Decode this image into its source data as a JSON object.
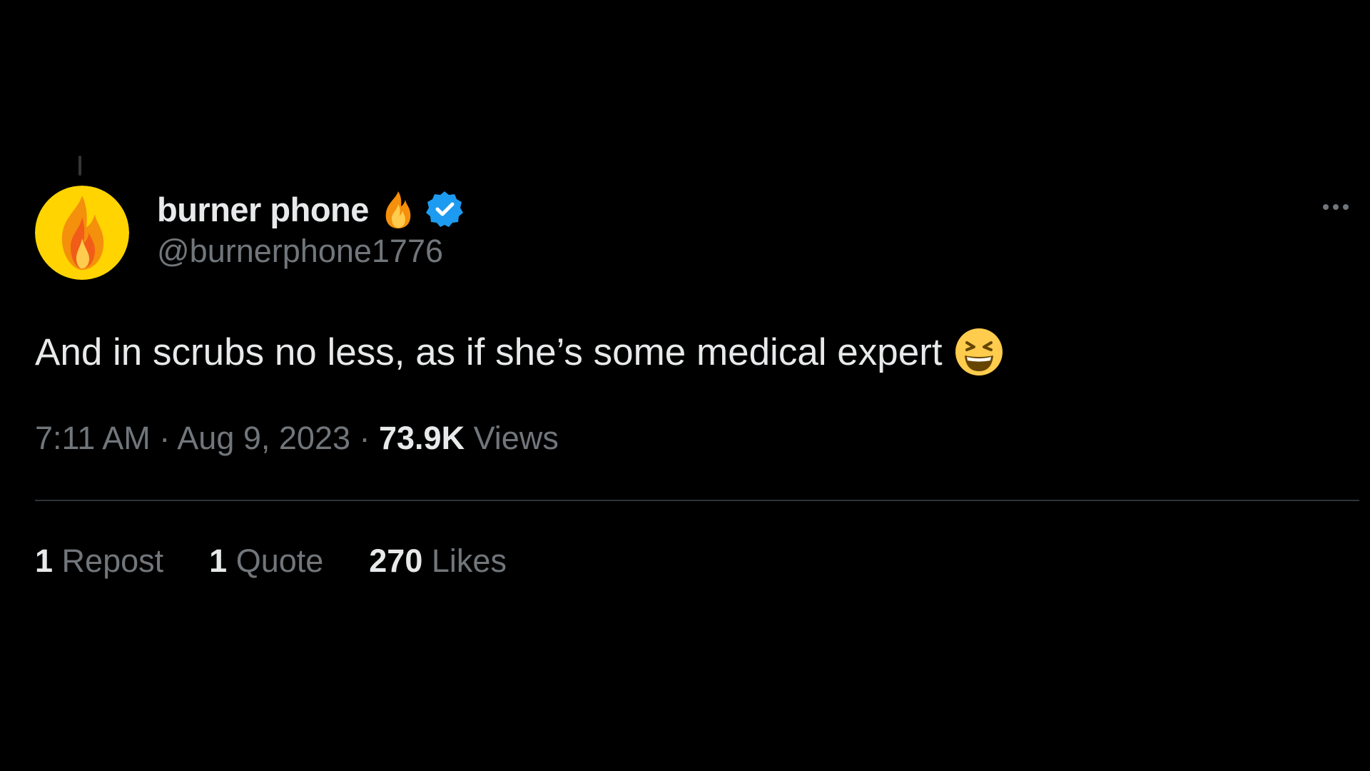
{
  "theme": {
    "background": "#000000",
    "primary_text": "#e7e9ea",
    "secondary_text": "#71767b",
    "verified_blue": "#1d9bf0",
    "divider": "#2f3336"
  },
  "author": {
    "display_name": "burner phone",
    "name_emoji": "fire-emoji",
    "verified_icon": "verified-badge-icon",
    "handle": "@burnerphone1776",
    "avatar": "fire-avatar"
  },
  "tweet": {
    "text": "And in scrubs no less, as if she’s some medical expert",
    "emoji": "grinning-squinting-face-emoji"
  },
  "meta": {
    "time": "7:11 AM",
    "separator": " · ",
    "date": "Aug 9, 2023",
    "views_count": "73.9K",
    "views_label": "Views"
  },
  "stats": {
    "reposts_count": "1",
    "reposts_label": "Repost",
    "quotes_count": "1",
    "quotes_label": "Quote",
    "likes_count": "270",
    "likes_label": "Likes"
  },
  "more_icon": "more-options-icon"
}
